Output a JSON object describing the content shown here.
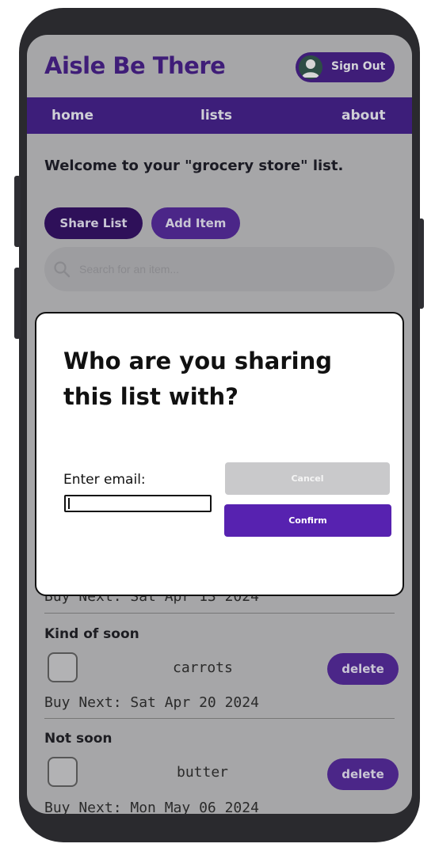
{
  "app": {
    "title": "Aisle Be There"
  },
  "header": {
    "signout_label": "Sign Out"
  },
  "nav": {
    "items": [
      {
        "label": "home"
      },
      {
        "label": "lists"
      },
      {
        "label": "about"
      }
    ]
  },
  "list": {
    "welcome": "Welcome to your \"grocery store\" list.",
    "share_label": "Share List",
    "add_label": "Add Item",
    "search_placeholder": "Search for an item..."
  },
  "groups": [
    {
      "title": "",
      "items": [
        {
          "name": "",
          "buy_next": "Buy Next: Sat Apr 13 2024"
        }
      ]
    },
    {
      "title": "Kind of soon",
      "items": [
        {
          "name": "carrots",
          "buy_next": "Buy Next: Sat Apr 20 2024",
          "checked": false,
          "delete_label": "delete"
        }
      ]
    },
    {
      "title": "Not soon",
      "items": [
        {
          "name": "butter",
          "buy_next": "Buy Next: Mon May 06 2024",
          "checked": false,
          "delete_label": "delete"
        }
      ]
    }
  ],
  "modal": {
    "title": "Who are you sharing this list with?",
    "email_label": "Enter email:",
    "email_value": "",
    "cancel_label": "Cancel",
    "confirm_label": "Confirm"
  },
  "colors": {
    "brand_purple": "#3f1d78",
    "navbar": "#3d1e7a",
    "confirm": "#5722b0",
    "cancel": "#c9c9cb",
    "overlay_gray": "#a6a6a8"
  },
  "icons": {
    "avatar": "user-icon",
    "search": "search-icon"
  }
}
